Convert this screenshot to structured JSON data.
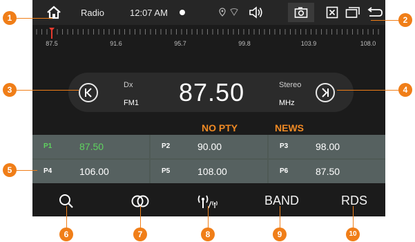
{
  "status_bar": {
    "app_title": "Radio",
    "time": "12:07 AM",
    "icons": [
      "home-icon",
      "location-icon",
      "wifi-icon",
      "volume-icon",
      "camera-icon",
      "close-box-icon",
      "recent-apps-icon",
      "back-icon"
    ]
  },
  "ruler": {
    "labels": [
      "87.5",
      "91.6",
      "95.7",
      "99.8",
      "103.9",
      "108.0"
    ],
    "indicator": "87.5"
  },
  "tuner": {
    "dx": "Dx",
    "band": "FM1",
    "frequency": "87.50",
    "mode": "Stereo",
    "unit": "MHz",
    "prev_icon": "seek-prev-icon",
    "next_icon": "seek-next-icon"
  },
  "rds": {
    "pty": "NO PTY",
    "pty_type": "NEWS"
  },
  "presets": [
    {
      "id": "P1",
      "value": "87.50",
      "active": true
    },
    {
      "id": "P2",
      "value": "90.00",
      "active": false
    },
    {
      "id": "P3",
      "value": "98.00",
      "active": false
    },
    {
      "id": "P4",
      "value": "106.00",
      "active": false
    },
    {
      "id": "P5",
      "value": "108.00",
      "active": false
    },
    {
      "id": "P6",
      "value": "87.50",
      "active": false
    }
  ],
  "bottom_bar": {
    "search_icon": "search-icon",
    "stereo_icon": "stereo-icon",
    "antenna_icon": "antenna-icon",
    "band": "BAND",
    "rds": "RDS"
  },
  "callouts": [
    "1",
    "2",
    "3",
    "4",
    "5",
    "6",
    "7",
    "8",
    "9",
    "10"
  ],
  "colors": {
    "accent": "#f07e18",
    "active_preset": "#5fd35f",
    "background": "#1b1b1b",
    "preset_bg": "#566160"
  }
}
